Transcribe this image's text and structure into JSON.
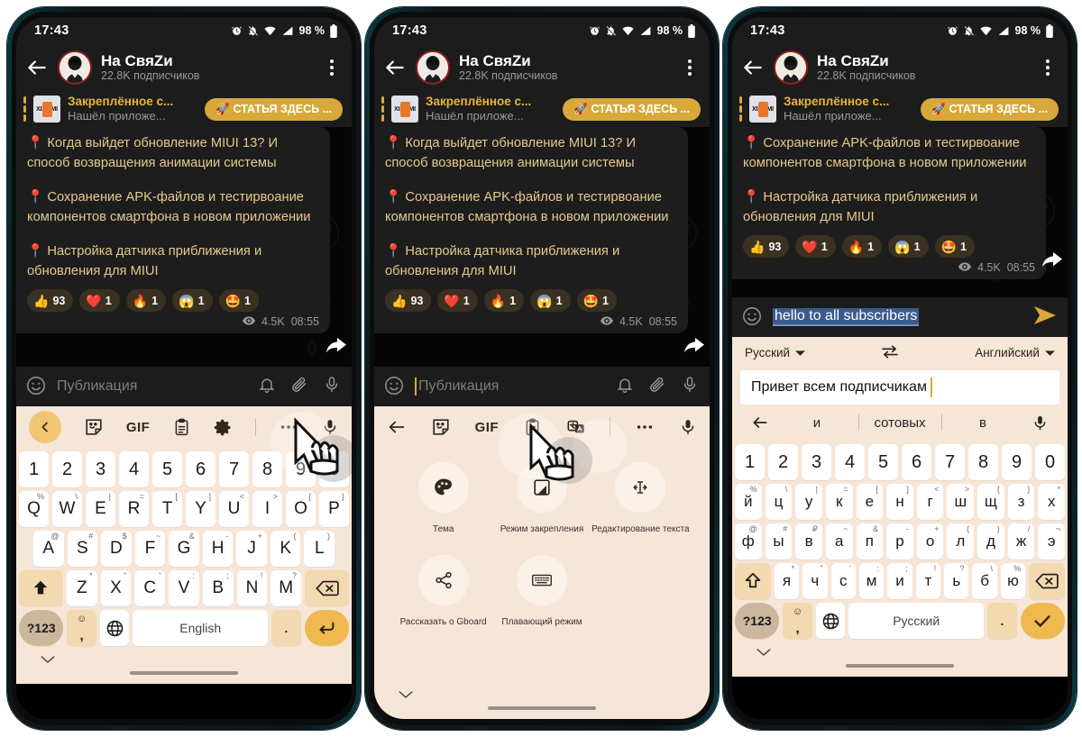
{
  "status_bar": {
    "time": "17:43",
    "battery": "98 %",
    "icons": [
      "alarm-icon",
      "bell-muted-icon",
      "wifi-icon",
      "signal-icon",
      "battery-icon"
    ]
  },
  "chat_header": {
    "title": "На СвяZи",
    "subtitle": "22.8K подписчиков",
    "back_label": "back-arrow",
    "menu_label": "overflow-menu"
  },
  "pinned": {
    "title": "Закреплённое с...",
    "subtitle": "Нашёл приложе...",
    "button": "🚀 СТАТЬЯ ЗДЕСЬ ...",
    "thumb_label": "XIAOMI"
  },
  "message_full": {
    "lines": [
      "📍 Когда выйдет обновление MIUI 13? И способ возвращения анимации системы",
      "📍 Сохранение APK-файлов и тестирвоание компонентов смартфона в новом приложении",
      "📍 Настройка датчика приближения и обновления для MIUI"
    ],
    "views": "4.5K",
    "time": "08:55"
  },
  "message_short": {
    "lines": [
      "📍 Сохранение APK-файлов и тестирвоание компонентов смартфона в новом приложении",
      "📍 Настройка датчика приближения и обновления для MIUI"
    ],
    "views": "4.5K",
    "time": "08:55"
  },
  "reactions": [
    {
      "emoji": "👍",
      "count": "93"
    },
    {
      "emoji": "❤️",
      "count": "1"
    },
    {
      "emoji": "🔥",
      "count": "1"
    },
    {
      "emoji": "😱",
      "count": "1"
    },
    {
      "emoji": "🤩",
      "count": "1"
    }
  ],
  "composer": {
    "placeholder": "Публикация",
    "icons": [
      "emoji-icon",
      "bell-icon",
      "attach-icon",
      "mic-icon"
    ]
  },
  "composer_translated": {
    "selected_text": "hello to all subscribers",
    "icons": [
      "emoji-icon",
      "send-icon"
    ]
  },
  "keyboard_toolbar_1": {
    "items": [
      "chevron-left-pill",
      "sticker-icon",
      "GIF",
      "clipboard-icon",
      "gear-icon",
      "overflow-icon",
      "mic-icon"
    ],
    "gif_label": "GIF"
  },
  "keyboard_toolbar_2": {
    "items": [
      "back-arrow-icon",
      "sticker-icon",
      "GIF",
      "clipboard-icon",
      "translate-icon",
      "overflow-icon",
      "mic-icon"
    ],
    "gif_label": "GIF"
  },
  "gboard_menu": {
    "rows": [
      [
        {
          "icon": "palette-icon",
          "label": "Тема"
        },
        {
          "icon": "one-handed-icon",
          "label": "Режим закрепления"
        },
        {
          "icon": "text-edit-icon",
          "label": "Редактирование текста"
        }
      ],
      [
        {
          "icon": "share-icon",
          "label": "Рассказать о Gboard"
        },
        {
          "icon": "keyboard-icon",
          "label": "Плавающий режим"
        },
        {
          "icon": "",
          "label": ""
        }
      ]
    ]
  },
  "translate_bar": {
    "source_lang": "Русский",
    "target_lang": "Английский",
    "swap_icon": "swap-icon",
    "translated_text": "Привет всем подписчикам",
    "suggestions": [
      "и",
      "сотовых",
      "в"
    ],
    "mic_icon": "mic-icon"
  },
  "keyboard_latin": {
    "numbers": [
      "1",
      "2",
      "3",
      "4",
      "5",
      "6",
      "7",
      "8",
      "9",
      "0"
    ],
    "row1": [
      {
        "k": "Q",
        "alt": "%"
      },
      {
        "k": "W",
        "alt": "\\"
      },
      {
        "k": "E",
        "alt": "|"
      },
      {
        "k": "R",
        "alt": "="
      },
      {
        "k": "T",
        "alt": "["
      },
      {
        "k": "Y",
        "alt": "]"
      },
      {
        "k": "U",
        "alt": "<"
      },
      {
        "k": "I",
        "alt": ">"
      },
      {
        "k": "O",
        "alt": "{"
      },
      {
        "k": "P",
        "alt": "}"
      }
    ],
    "row2": [
      {
        "k": "A",
        "alt": "@"
      },
      {
        "k": "S",
        "alt": "#"
      },
      {
        "k": "D",
        "alt": "$"
      },
      {
        "k": "F",
        "alt": "~"
      },
      {
        "k": "G",
        "alt": "&"
      },
      {
        "k": "H",
        "alt": "-"
      },
      {
        "k": "J",
        "alt": "+"
      },
      {
        "k": "K",
        "alt": "("
      },
      {
        "k": "L",
        "alt": ")"
      }
    ],
    "row3": [
      {
        "k": "Z",
        "alt": "*"
      },
      {
        "k": "X",
        "alt": "\""
      },
      {
        "k": "C",
        "alt": "'"
      },
      {
        "k": "V",
        "alt": ":"
      },
      {
        "k": "B",
        "alt": ";"
      },
      {
        "k": "N",
        "alt": "!"
      },
      {
        "k": "M",
        "alt": "?"
      }
    ],
    "shift": "shift-icon",
    "backspace": "backspace-icon",
    "symbols": "?123",
    "comma_top": "☺",
    "comma_bottom": ",",
    "globe": "globe-icon",
    "space": "English",
    "period": ".",
    "enter": "enter-icon"
  },
  "keyboard_cyrillic": {
    "numbers": [
      "1",
      "2",
      "3",
      "4",
      "5",
      "6",
      "7",
      "8",
      "9",
      "0"
    ],
    "row1": [
      {
        "k": "й",
        "alt": "%"
      },
      {
        "k": "ц",
        "alt": "\\"
      },
      {
        "k": "у",
        "alt": "|"
      },
      {
        "k": "к",
        "alt": "="
      },
      {
        "k": "е",
        "alt": "["
      },
      {
        "k": "н",
        "alt": "]"
      },
      {
        "k": "г",
        "alt": "<"
      },
      {
        "k": "ш",
        "alt": ">"
      },
      {
        "k": "щ",
        "alt": "{"
      },
      {
        "k": "з",
        "alt": "}"
      },
      {
        "k": "х",
        "alt": "*"
      }
    ],
    "row2": [
      {
        "k": "ф",
        "alt": "@"
      },
      {
        "k": "ы",
        "alt": "#"
      },
      {
        "k": "в",
        "alt": "₽"
      },
      {
        "k": "а",
        "alt": "~"
      },
      {
        "k": "п",
        "alt": "&"
      },
      {
        "k": "р",
        "alt": "-"
      },
      {
        "k": "о",
        "alt": "+"
      },
      {
        "k": "л",
        "alt": "("
      },
      {
        "k": "д",
        "alt": ")"
      },
      {
        "k": "ж",
        "alt": "/"
      },
      {
        "k": "э",
        "alt": "¬"
      }
    ],
    "row3": [
      {
        "k": "я",
        "alt": "*"
      },
      {
        "k": "ч",
        "alt": "\""
      },
      {
        "k": "с",
        "alt": "'"
      },
      {
        "k": "м",
        "alt": ":"
      },
      {
        "k": "и",
        "alt": ";"
      },
      {
        "k": "т",
        "alt": "!"
      },
      {
        "k": "ь",
        "alt": "?"
      },
      {
        "k": "б",
        "alt": "\\"
      },
      {
        "k": "ю",
        "alt": "%"
      }
    ],
    "shift": "shift-outline-icon",
    "backspace": "backspace-icon",
    "symbols": "?123",
    "comma_top": "☺",
    "comma_bottom": ",",
    "globe": "globe-icon",
    "space": "Русский",
    "period": ".",
    "enter": "check-icon"
  },
  "colors": {
    "accent_gold": "#d9a83a",
    "keyboard_bg": "#f6e6d8",
    "key_bg": "#ffffff",
    "fn_key_bg": "#f3d9b0",
    "enter_key_bg": "#efb950",
    "chat_bg": "#050505",
    "bubble_bg": "#1d1d1d",
    "bubble_text": "#e6c98c",
    "bar_bg": "#1c1c1c",
    "frame_teal": "#0d4049",
    "selection_blue": "#3b5b8c"
  }
}
